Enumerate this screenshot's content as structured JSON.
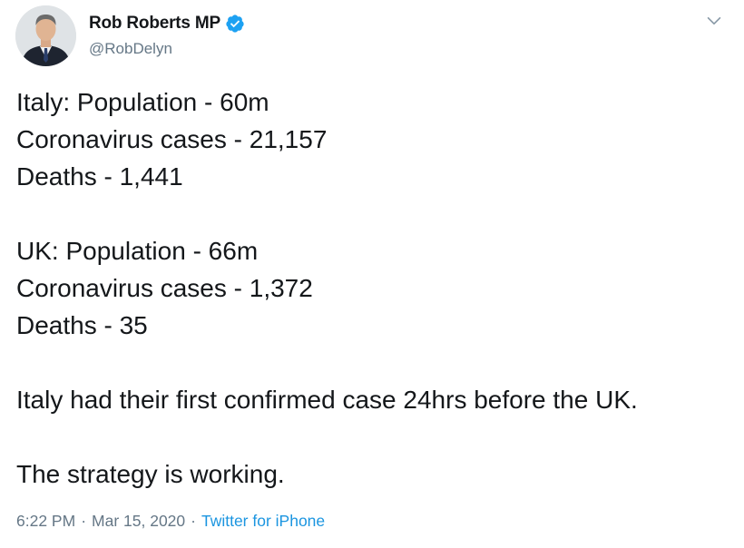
{
  "author": {
    "name": "Rob Roberts MP",
    "handle": "@RobDelyn",
    "verified": true
  },
  "icons": {
    "verified": "verified-badge-icon",
    "caret": "chevron-down-icon",
    "verified_color": "#1da1f2"
  },
  "tweet": {
    "lines": [
      "Italy: Population - 60m",
      "Coronavirus cases - 21,157",
      "Deaths - 1,441",
      "",
      "UK: Population - 66m",
      "Coronavirus cases - 1,372",
      "Deaths - 35",
      "",
      "Italy had their first confirmed case 24hrs before the UK.",
      "",
      "The strategy is working."
    ]
  },
  "meta": {
    "time": "6:22 PM",
    "separator": "·",
    "date": "Mar 15, 2020",
    "source": "Twitter for iPhone"
  },
  "colors": {
    "text": "#14171a",
    "secondary": "#657786",
    "link": "#1b95e0"
  }
}
